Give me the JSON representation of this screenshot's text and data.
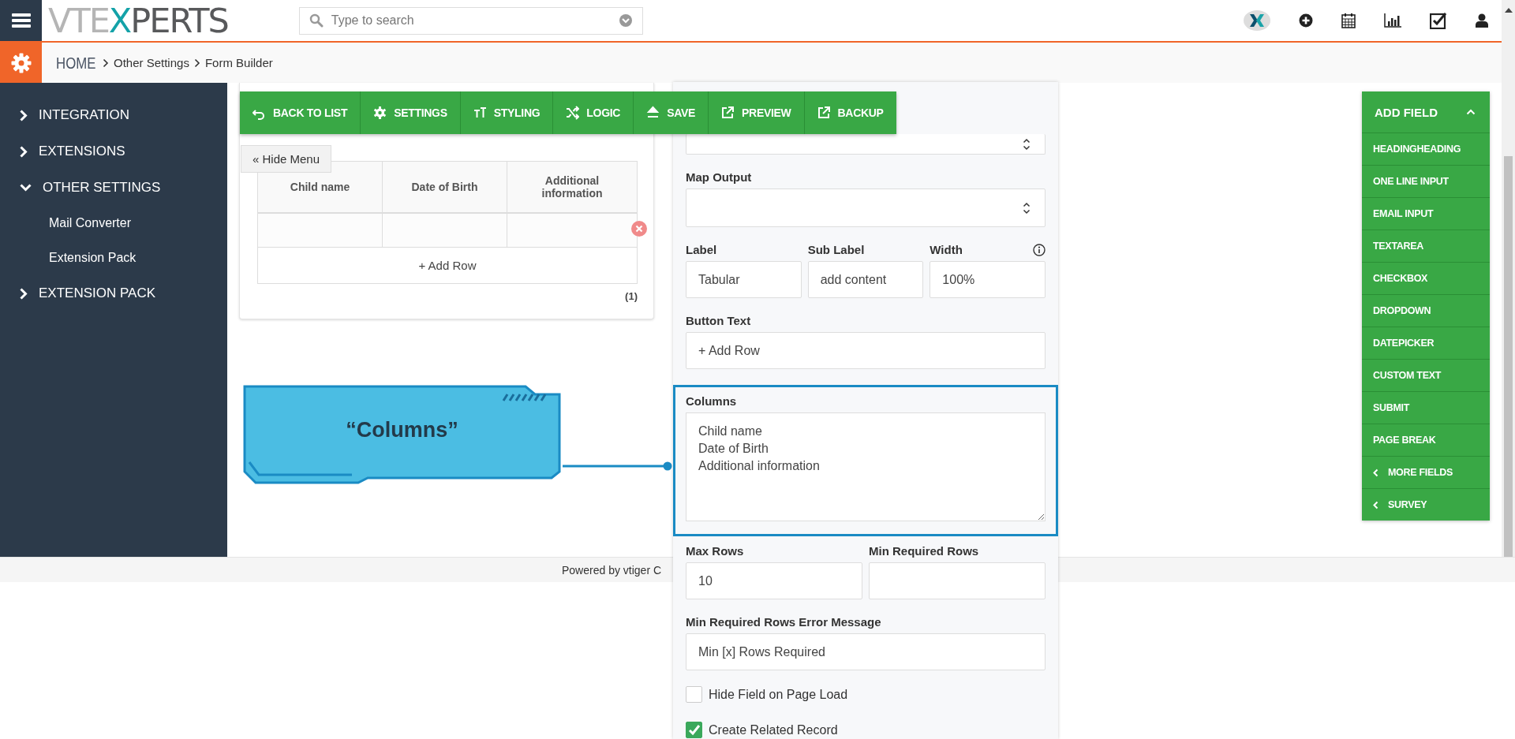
{
  "header": {
    "logo": [
      {
        "text": "VTE",
        "color": "#b5b5b5"
      },
      {
        "text": "X",
        "color": "#14a2a8"
      },
      {
        "text": "PERTS",
        "color": "#58595b"
      }
    ],
    "search": {
      "placeholder": "Type to search"
    }
  },
  "breadcrumb": [
    "HOME",
    "Other Settings",
    "Form Builder"
  ],
  "sidebar": {
    "items": [
      {
        "label": "INTEGRATION",
        "expanded": false
      },
      {
        "label": "EXTENSIONS",
        "expanded": false
      },
      {
        "label": "OTHER SETTINGS",
        "expanded": true,
        "children": [
          {
            "label": "Mail Converter"
          },
          {
            "label": "Extension Pack"
          }
        ]
      },
      {
        "label": "EXTENSION PACK",
        "expanded": false
      }
    ]
  },
  "toolbar": [
    "BACK TO LIST",
    "SETTINGS",
    "STYLING",
    "LOGIC",
    "SAVE",
    "PREVIEW",
    "BACKUP"
  ],
  "form_preview": {
    "hide_menu": "« Hide Menu",
    "columns": [
      "Child name",
      "Date of Birth",
      "Additional information"
    ],
    "add_row": "+ Add Row",
    "counter": "(1)"
  },
  "callout": {
    "text": "“Columns”"
  },
  "settings_panel": {
    "fields": [
      {
        "kind": "select"
      },
      {
        "kind": "select",
        "label": "Map Output"
      },
      {
        "kind": "inputs",
        "items": [
          {
            "label": "Label",
            "value": "Tabular"
          },
          {
            "label": "Sub Label",
            "value": "add content"
          },
          {
            "label": "Width",
            "value": "100%",
            "hint_icon": true
          }
        ]
      },
      {
        "kind": "input",
        "label": "Button Text",
        "value": "+ Add Row"
      },
      {
        "kind": "textarea",
        "label": "Columns",
        "value": "Child name\nDate of Birth\nAdditional information",
        "highlighted": true
      },
      {
        "kind": "inputs",
        "items": [
          {
            "label": "Max Rows",
            "value": "10"
          },
          {
            "label": "Min Required Rows",
            "value": ""
          }
        ]
      },
      {
        "kind": "input",
        "label": "Min Required Rows Error Message",
        "value": "Min [x] Rows Required"
      },
      {
        "kind": "checkbox",
        "label": "Hide Field on Page Load",
        "checked": false
      },
      {
        "kind": "checkbox",
        "label": "Create Related Record",
        "checked": true
      }
    ]
  },
  "add_field": {
    "title": "ADD FIELD",
    "expanded": true,
    "items": [
      {
        "label": "HEADINGHEADING",
        "kind": "field"
      },
      {
        "label": "ONE LINE INPUT",
        "kind": "field"
      },
      {
        "label": "EMAIL INPUT",
        "kind": "field"
      },
      {
        "label": "TEXTAREA",
        "kind": "field"
      },
      {
        "label": "CHECKBOX",
        "kind": "field"
      },
      {
        "label": "DROPDOWN",
        "kind": "field"
      },
      {
        "label": "DATEPICKER",
        "kind": "field"
      },
      {
        "label": "CUSTOM TEXT",
        "kind": "field"
      },
      {
        "label": "SUBMIT",
        "kind": "field"
      },
      {
        "label": "PAGE BREAK",
        "kind": "field"
      },
      {
        "label": "MORE FIELDS",
        "kind": "submenu"
      },
      {
        "label": "SURVEY",
        "kind": "submenu"
      }
    ]
  },
  "footer": {
    "text": "Powered by vtiger C"
  }
}
